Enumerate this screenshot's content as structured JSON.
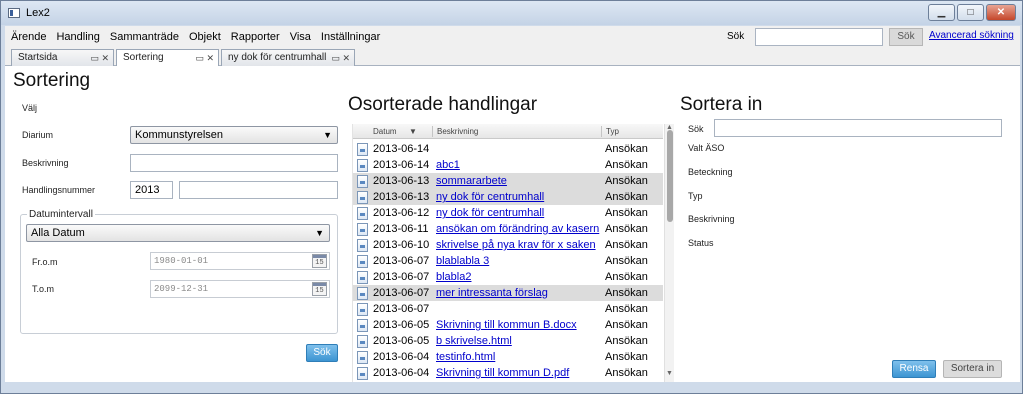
{
  "window": {
    "title": "Lex2",
    "min": "▁",
    "max": "□",
    "close": "✕"
  },
  "menu": [
    "Ärende",
    "Handling",
    "Sammanträde",
    "Objekt",
    "Rapporter",
    "Visa",
    "Inställningar"
  ],
  "search": {
    "label": "Sök",
    "button": "Sök",
    "advanced": "Avancerad sökning",
    "value": ""
  },
  "tabs": [
    {
      "label": "Startsida",
      "icons": "▭ ✕"
    },
    {
      "label": "Sortering",
      "icons": "▭ ✕"
    },
    {
      "label": "ny dok för centrumhall",
      "icons": "▭ ✕"
    }
  ],
  "sortering": {
    "title": "Sortering",
    "valj": "Välj",
    "diarium_label": "Diarium",
    "diarium_value": "Kommunstyrelsen",
    "beskrivning_label": "Beskrivning",
    "beskrivning_value": "",
    "handlingsnummer_label": "Handlingsnummer",
    "handlingsnummer_year": "2013",
    "handlingsnummer_value": "",
    "datum_group": "Datumintervall",
    "datum_select": "Alla Datum",
    "from_label": "Fr.o.m",
    "from_value": "1980-01-01",
    "to_label": "T.o.m",
    "to_value": "2099-12-31",
    "cal_label": "15",
    "sok_button": "Sök"
  },
  "osorterade": {
    "title": "Osorterade handlingar",
    "columns": {
      "datum": "Datum",
      "sort_arrow": "▼",
      "beskrivning": "Beskrivning",
      "typ": "Typ"
    },
    "rows": [
      {
        "date": "2013-06-14",
        "desc": "",
        "typ": "Ansökan",
        "sel": false
      },
      {
        "date": "2013-06-14",
        "desc": "abc1",
        "typ": "Ansökan",
        "sel": false
      },
      {
        "date": "2013-06-13",
        "desc": "sommararbete",
        "typ": "Ansökan",
        "sel": true
      },
      {
        "date": "2013-06-13",
        "desc": "ny dok för centrumhall",
        "typ": "Ansökan",
        "sel": true
      },
      {
        "date": "2013-06-12",
        "desc": "ny dok för centrumhall",
        "typ": "Ansökan",
        "sel": false
      },
      {
        "date": "2013-06-11",
        "desc": "ansökan om förändring av kasern",
        "typ": "Ansökan",
        "sel": false
      },
      {
        "date": "2013-06-10",
        "desc": "skrivelse på nya krav för x saken",
        "typ": "Ansökan",
        "sel": false
      },
      {
        "date": "2013-06-07",
        "desc": "blablabla 3",
        "typ": "Ansökan",
        "sel": false
      },
      {
        "date": "2013-06-07",
        "desc": "blabla2",
        "typ": "Ansökan",
        "sel": false
      },
      {
        "date": "2013-06-07",
        "desc": "mer intressanta förslag",
        "typ": "Ansökan",
        "sel": true
      },
      {
        "date": "2013-06-07",
        "desc": "",
        "typ": "Ansökan",
        "sel": false
      },
      {
        "date": "2013-06-05",
        "desc": "Skrivning till kommun B.docx",
        "typ": "Ansökan",
        "sel": false
      },
      {
        "date": "2013-06-05",
        "desc": "b skrivelse.html",
        "typ": "Ansökan",
        "sel": false
      },
      {
        "date": "2013-06-04",
        "desc": "testinfo.html",
        "typ": "Ansökan",
        "sel": false
      },
      {
        "date": "2013-06-04",
        "desc": "Skrivning till kommun D.pdf",
        "typ": "Ansökan",
        "sel": false
      }
    ],
    "scroll_up": "▲",
    "scroll_down": "▼"
  },
  "sortera_in": {
    "title": "Sortera in",
    "sok_label": "Sök",
    "sok_value": "",
    "valt_aso": "Valt ÄSO",
    "beteckning": "Beteckning",
    "typ": "Typ",
    "beskrivning": "Beskrivning",
    "status": "Status",
    "rensa_button": "Rensa",
    "sortera_button": "Sortera in"
  },
  "colors": {
    "accent_blue": "#3d95d2",
    "link": "#0000cc",
    "selected_row": "#dcdcdc",
    "window_frame": "#cfdbea"
  }
}
